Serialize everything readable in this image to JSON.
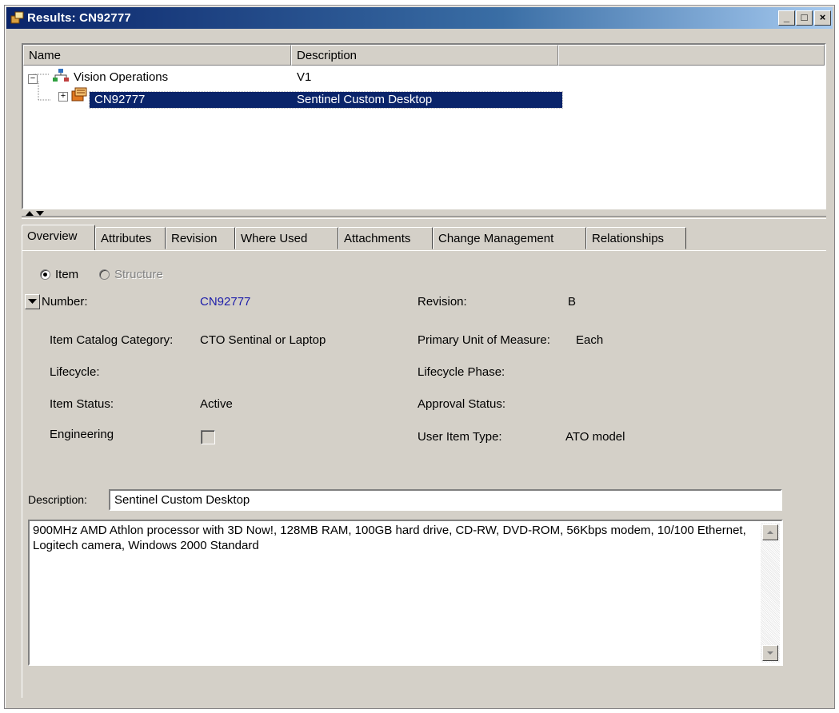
{
  "window": {
    "title": "Results: CN92777"
  },
  "tree": {
    "columns": [
      "Name",
      "Description",
      ""
    ],
    "rows": [
      {
        "name": "Vision Operations",
        "description": "V1",
        "expander": "−"
      },
      {
        "name": "CN92777",
        "description": "Sentinel Custom Desktop",
        "expander": "+"
      }
    ]
  },
  "tabs": [
    "Overview",
    "Attributes",
    "Revision",
    "Where Used",
    "Attachments",
    "Change Management",
    "Relationships"
  ],
  "overview": {
    "radio_item": "Item",
    "radio_structure": "Structure",
    "number_label": "Number:",
    "number_value": "CN92777",
    "revision_label": "Revision:",
    "revision_value": "B",
    "catalog_label": "Item Catalog Category:",
    "catalog_value": "CTO Sentinal or Laptop",
    "uom_label": "Primary Unit of Measure:",
    "uom_value": "Each",
    "lifecycle_label": "Lifecycle:",
    "lifecycle_phase_label": "Lifecycle Phase:",
    "item_status_label": "Item Status:",
    "item_status_value": "Active",
    "approval_label": "Approval Status:",
    "engineering_label": "Engineering",
    "user_item_type_label": "User Item Type:",
    "user_item_type_value": "ATO model",
    "description_label": "Description:",
    "description_value": "Sentinel Custom Desktop",
    "long_description": "900MHz AMD Athlon processor with 3D Now!, 128MB RAM, 100GB hard drive, CD-RW, DVD-ROM, 56Kbps modem, 10/100 Ethernet, Logitech camera, Windows 2000 Standard"
  }
}
